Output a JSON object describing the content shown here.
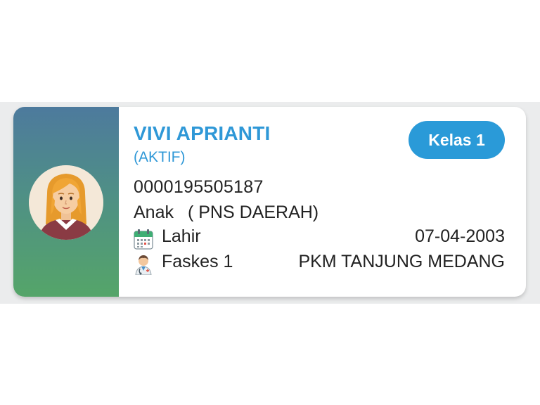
{
  "member": {
    "name": "VIVI APRIANTI",
    "status": "(AKTIF)",
    "class_badge": "Kelas 1",
    "card_number": "0000195505187",
    "relation": "Anak",
    "employment": "( PNS DAERAH)",
    "birth_label": "Lahir",
    "birth_date": "07-04-2003",
    "faskes_label": "Faskes 1",
    "faskes_name": "PKM TANJUNG MEDANG"
  },
  "icons": {
    "avatar": "female-avatar-icon",
    "birth": "calendar-icon",
    "faskes": "doctor-icon"
  },
  "colors": {
    "accent": "#2f98d7",
    "badge": "#2a9ad8",
    "side_gradient_top": "#4d7a9d",
    "side_gradient_bottom": "#55a569"
  }
}
